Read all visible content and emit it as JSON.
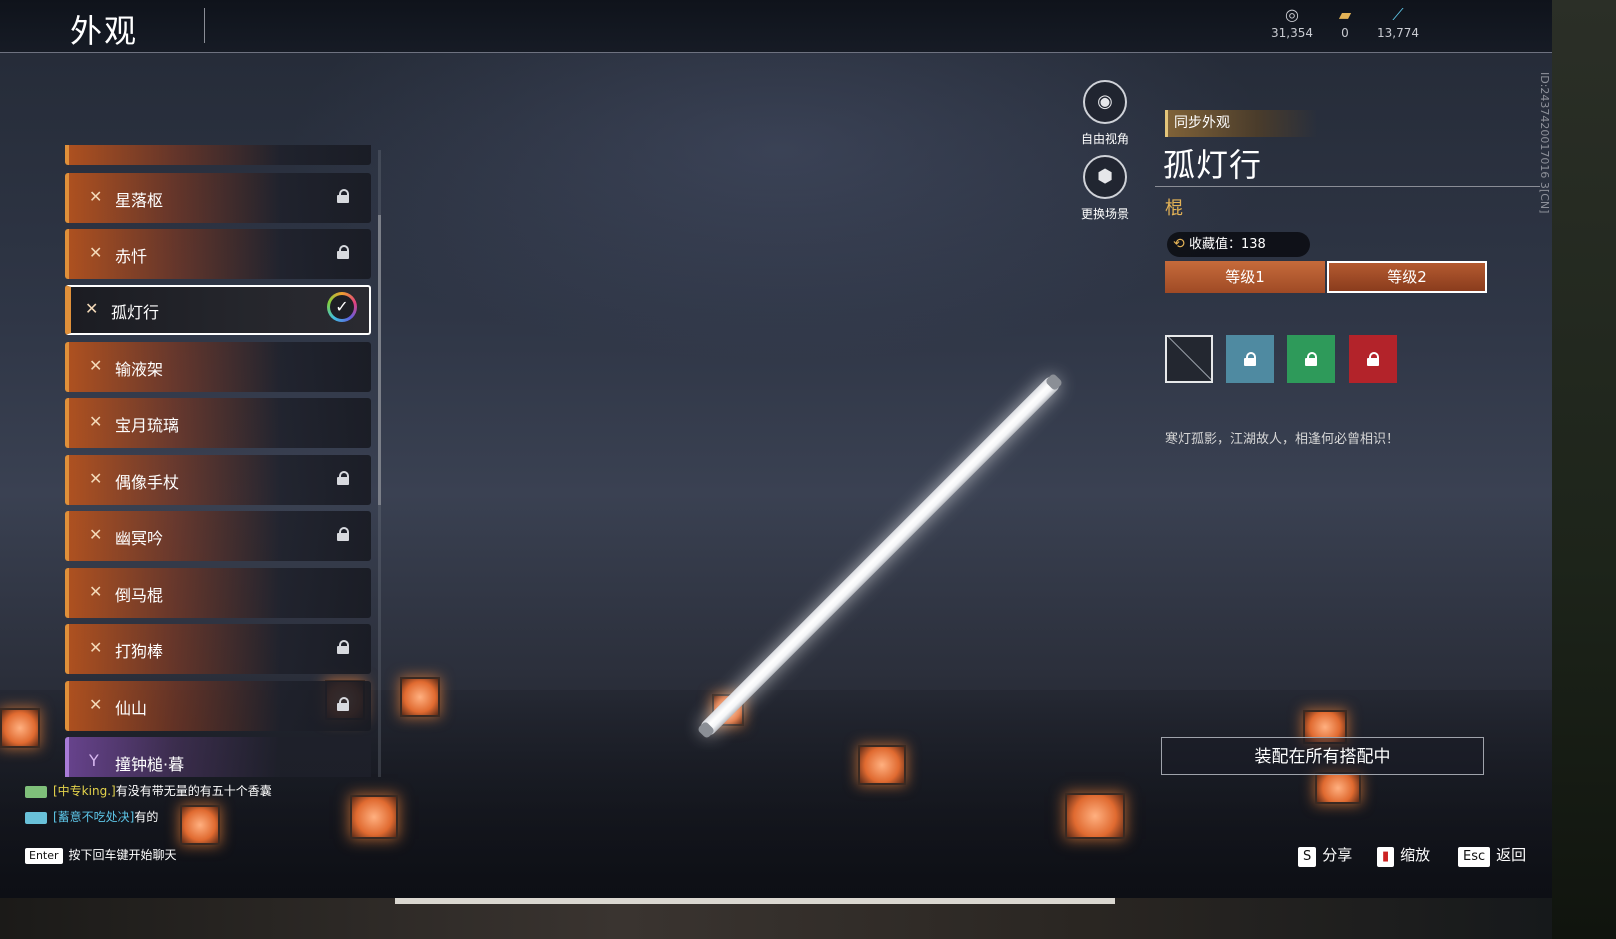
{
  "header": {
    "title": "外观",
    "currencies": [
      {
        "icon": "coin-icon",
        "value": "31,354"
      },
      {
        "icon": "ticket-icon",
        "value": "0"
      },
      {
        "icon": "feather-icon",
        "value": "13,774"
      }
    ]
  },
  "list": {
    "items": [
      {
        "name": "星落枢",
        "locked": true
      },
      {
        "name": "赤忏",
        "locked": true
      },
      {
        "name": "孤灯行",
        "selected": true
      },
      {
        "name": "输液架",
        "locked": false
      },
      {
        "name": "宝月琉璃",
        "locked": false
      },
      {
        "name": "偶像手杖",
        "locked": true
      },
      {
        "name": "幽冥吟",
        "locked": true
      },
      {
        "name": "倒马棍",
        "locked": false
      },
      {
        "name": "打狗棒",
        "locked": true
      },
      {
        "name": "仙山",
        "locked": true
      },
      {
        "name": "撞钟槌·暮",
        "locked": false,
        "purple": true
      }
    ]
  },
  "camera": {
    "free_view": "自由视角",
    "change_scene": "更换场景"
  },
  "detail": {
    "sync_label": "同步外观",
    "title": "孤灯行",
    "type": "棍",
    "collect_label": "收藏值：138",
    "levels": [
      "等级1",
      "等级2"
    ],
    "description": "寒灯孤影，江湖故人，相逢何必曾相识！",
    "equip_all": "装配在所有搭配中",
    "id_text": "ID:2437420017016 3[CN]"
  },
  "chat": {
    "lines": [
      {
        "name": "[中专king.]",
        "text": "有没有带无量的有五十个香囊"
      },
      {
        "name": "[蓄意不吃处决]",
        "text": "有的"
      }
    ],
    "enter_key": "Enter",
    "prompt": "按下回车键开始聊天"
  },
  "footer": {
    "share_key": "S",
    "share": "分享",
    "zoom": "缩放",
    "back_key": "Esc",
    "back": "返回"
  }
}
